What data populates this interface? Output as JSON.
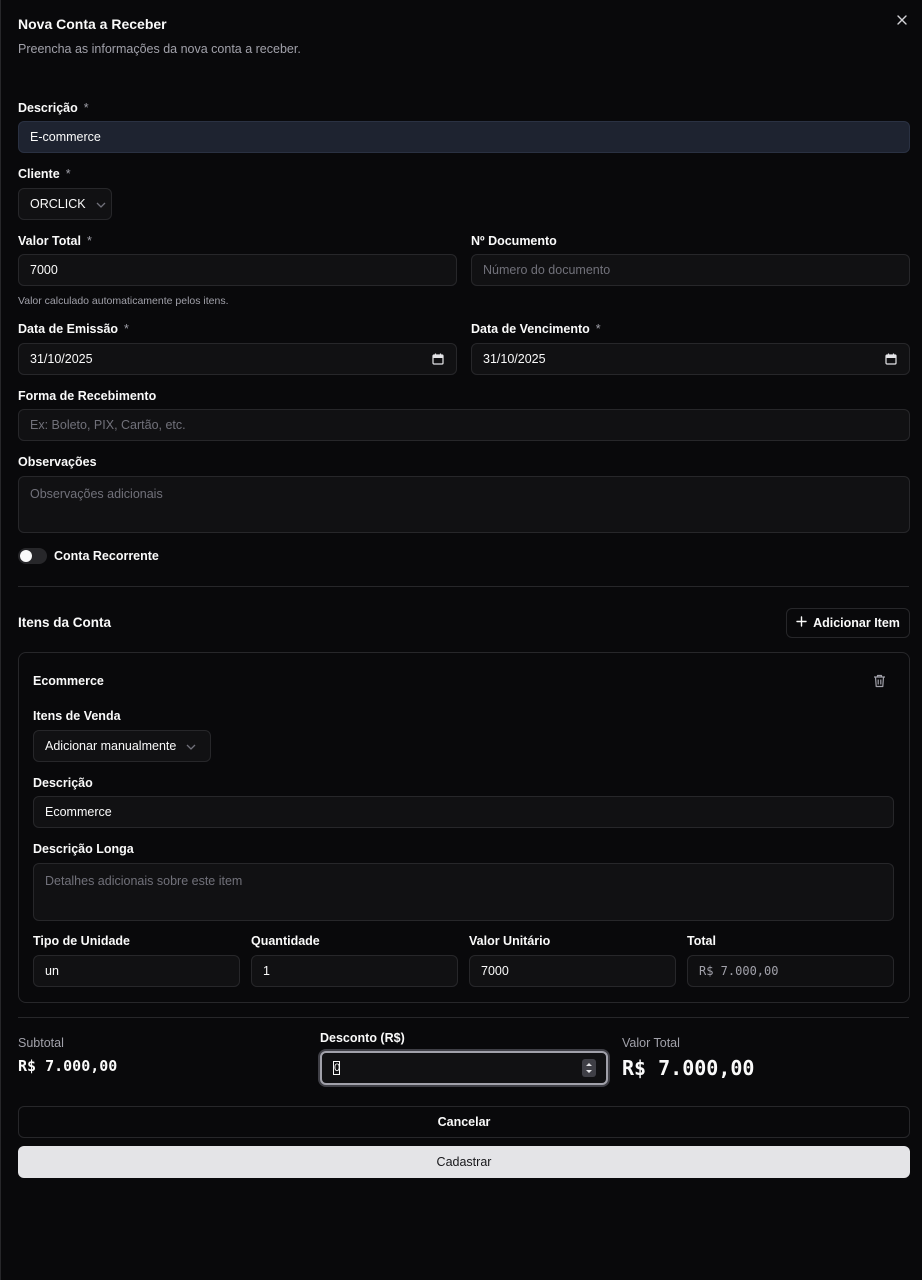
{
  "dialog": {
    "title": "Nova Conta a Receber",
    "subtitle": "Preencha as informações da nova conta a receber."
  },
  "form": {
    "descricao": {
      "label": "Descrição",
      "required": "*",
      "value": "E-commerce"
    },
    "cliente": {
      "label": "Cliente",
      "required": "*",
      "value": "ORCLICK"
    },
    "valor_total": {
      "label": "Valor Total",
      "required": "*",
      "value": "7000",
      "hint": "Valor calculado automaticamente pelos itens."
    },
    "documento": {
      "label": "Nº Documento",
      "placeholder": "Número do documento"
    },
    "emissao": {
      "label": "Data de Emissão",
      "required": "*",
      "value": "31/10/2025"
    },
    "vencimento": {
      "label": "Data de Vencimento",
      "required": "*",
      "value": "31/10/2025"
    },
    "forma": {
      "label": "Forma de Recebimento",
      "placeholder": "Ex: Boleto, PIX, Cartão, etc."
    },
    "observacoes": {
      "label": "Observações",
      "placeholder": "Observações adicionais"
    },
    "recorrente": {
      "label": "Conta Recorrente"
    }
  },
  "items_section": {
    "title": "Itens da Conta",
    "add_label": "Adicionar Item",
    "item": {
      "name": "Ecommerce",
      "itens_venda": {
        "label": "Itens de Venda",
        "value": "Adicionar manualmente"
      },
      "descricao": {
        "label": "Descrição",
        "value": "Ecommerce"
      },
      "descricao_longa": {
        "label": "Descrição Longa",
        "placeholder": "Detalhes adicionais sobre este item"
      },
      "tipo_unidade": {
        "label": "Tipo de Unidade",
        "value": "un"
      },
      "quantidade": {
        "label": "Quantidade",
        "value": "1"
      },
      "valor_unitario": {
        "label": "Valor Unitário",
        "value": "7000"
      },
      "total": {
        "label": "Total",
        "value": "R$ 7.000,00"
      }
    }
  },
  "summary": {
    "subtotal_label": "Subtotal",
    "subtotal_value": "R$ 7.000,00",
    "desconto_label": "Desconto (R$)",
    "desconto_value": "0",
    "total_label": "Valor Total",
    "total_value": "R$ 7.000,00"
  },
  "actions": {
    "cancel": "Cancelar",
    "submit": "Cadastrar"
  }
}
